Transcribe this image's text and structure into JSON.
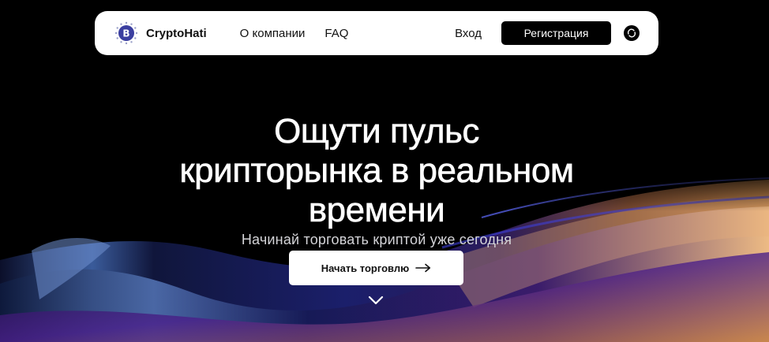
{
  "header": {
    "brand": {
      "name": "CryptoHati",
      "logo_icon": "bitcoin-badge-icon"
    },
    "nav_links": [
      {
        "label": "О компании"
      },
      {
        "label": "FAQ"
      }
    ],
    "login_label": "Вход",
    "register_label": "Регистрация",
    "theme_toggle_icon": "theme-toggle-icon"
  },
  "hero": {
    "title_lines": [
      "Ощути пульс",
      "крипторынка в реальном",
      "времени"
    ],
    "subtitle": "Начинай торговать криптой уже сегодня",
    "cta_label": "Начать торговлю",
    "cta_icon": "arrow-right-icon",
    "scroll_icon": "chevron-down-icon"
  },
  "colors": {
    "background": "#000000",
    "navbar": "#ffffff",
    "primary_button": "#000000",
    "cta_button": "#ffffff",
    "logo_accent": "#3b3fa0"
  }
}
